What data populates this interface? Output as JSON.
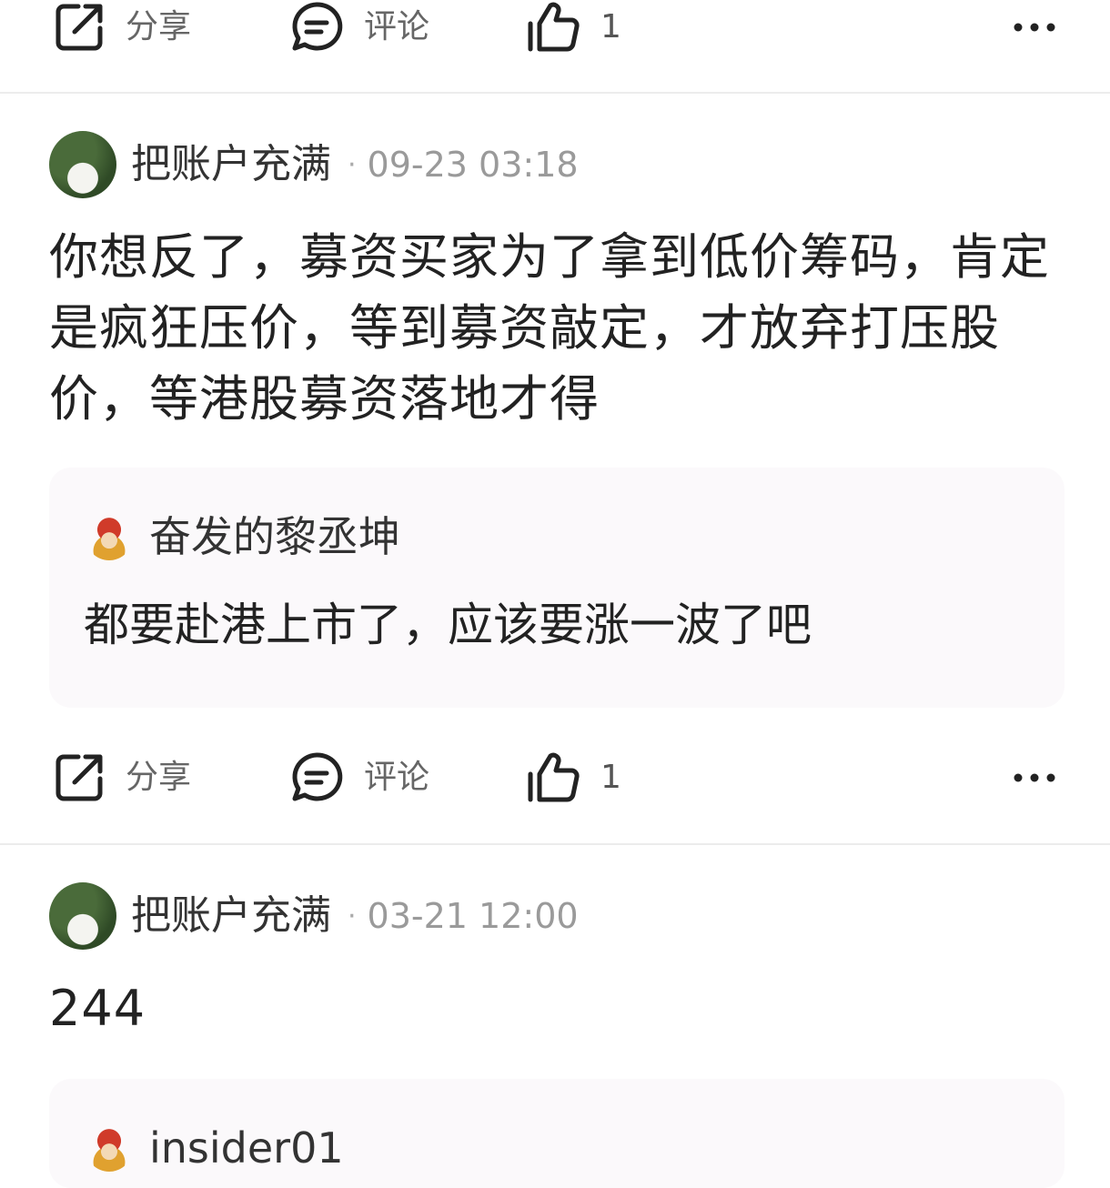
{
  "actions": {
    "share": "分享",
    "comment": "评论"
  },
  "bars": [
    {
      "likes": "1"
    },
    {
      "likes": "1"
    }
  ],
  "posts": [
    {
      "username": "把账户充满",
      "separator": "·",
      "time": "09-23 03:18",
      "text": "你想反了，募资买家为了拿到低价筹码，肯定是疯狂压价，等到募资敲定，才放弃打压股价，等港股募资落地才得",
      "quote": {
        "username": "奋发的黎丞坤",
        "text": "都要赴港上市了，应该要涨一波了吧"
      }
    },
    {
      "username": "把账户充满",
      "separator": "·",
      "time": "03-21 12:00",
      "text": "244",
      "quote": {
        "username": "insider01"
      }
    }
  ],
  "icons": {
    "share": "share-icon",
    "comment": "comment-icon",
    "like": "thumbs-up-icon",
    "more": "more-icon"
  }
}
